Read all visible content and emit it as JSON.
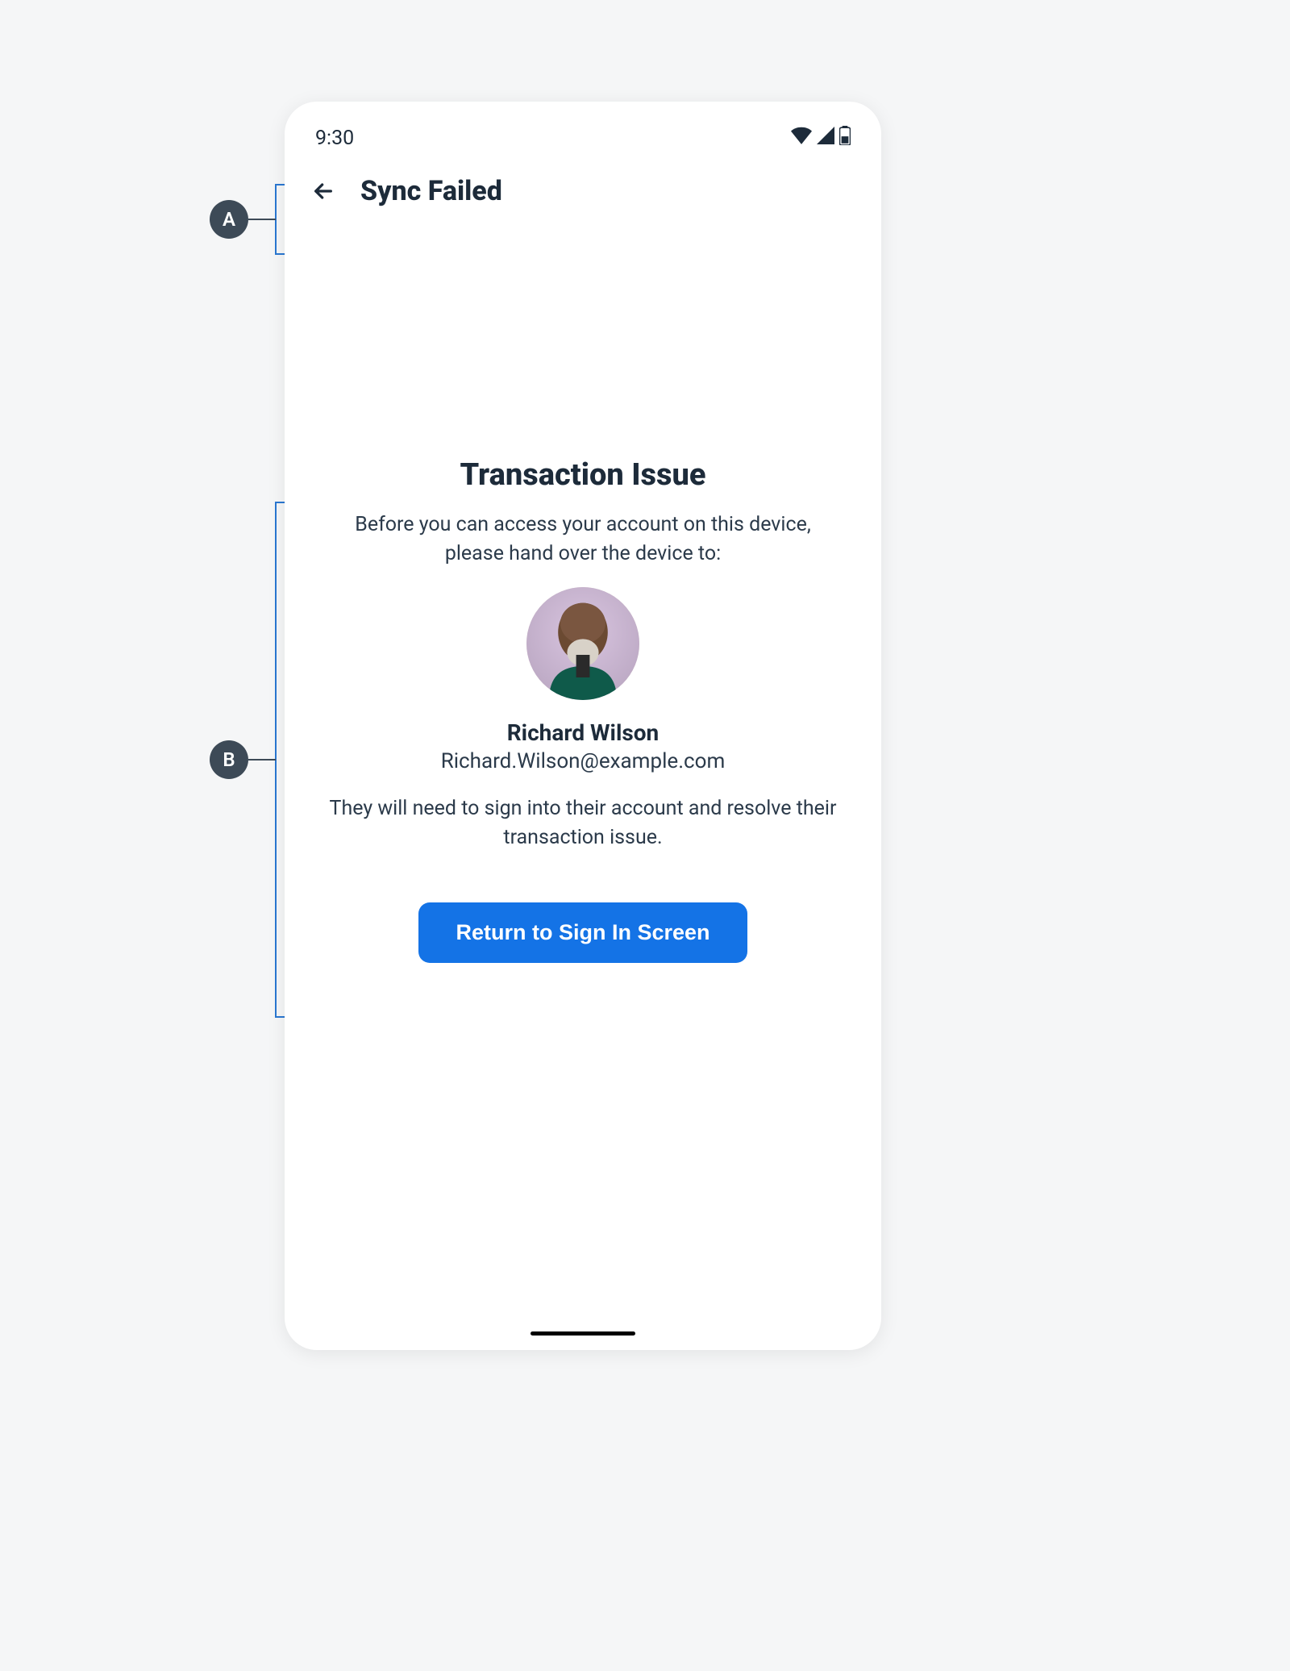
{
  "annotations": {
    "a": "A",
    "b": "B"
  },
  "status": {
    "time": "9:30"
  },
  "appbar": {
    "title": "Sync Failed"
  },
  "content": {
    "title": "Transaction Issue",
    "intro": "Before you can access your account on this device, please hand over the device to:",
    "user_name": "Richard Wilson",
    "user_email": "Richard.Wilson@example.com",
    "instruction": "They will need to sign into their account and resolve their transaction issue.",
    "button_label": "Return to Sign In Screen"
  }
}
